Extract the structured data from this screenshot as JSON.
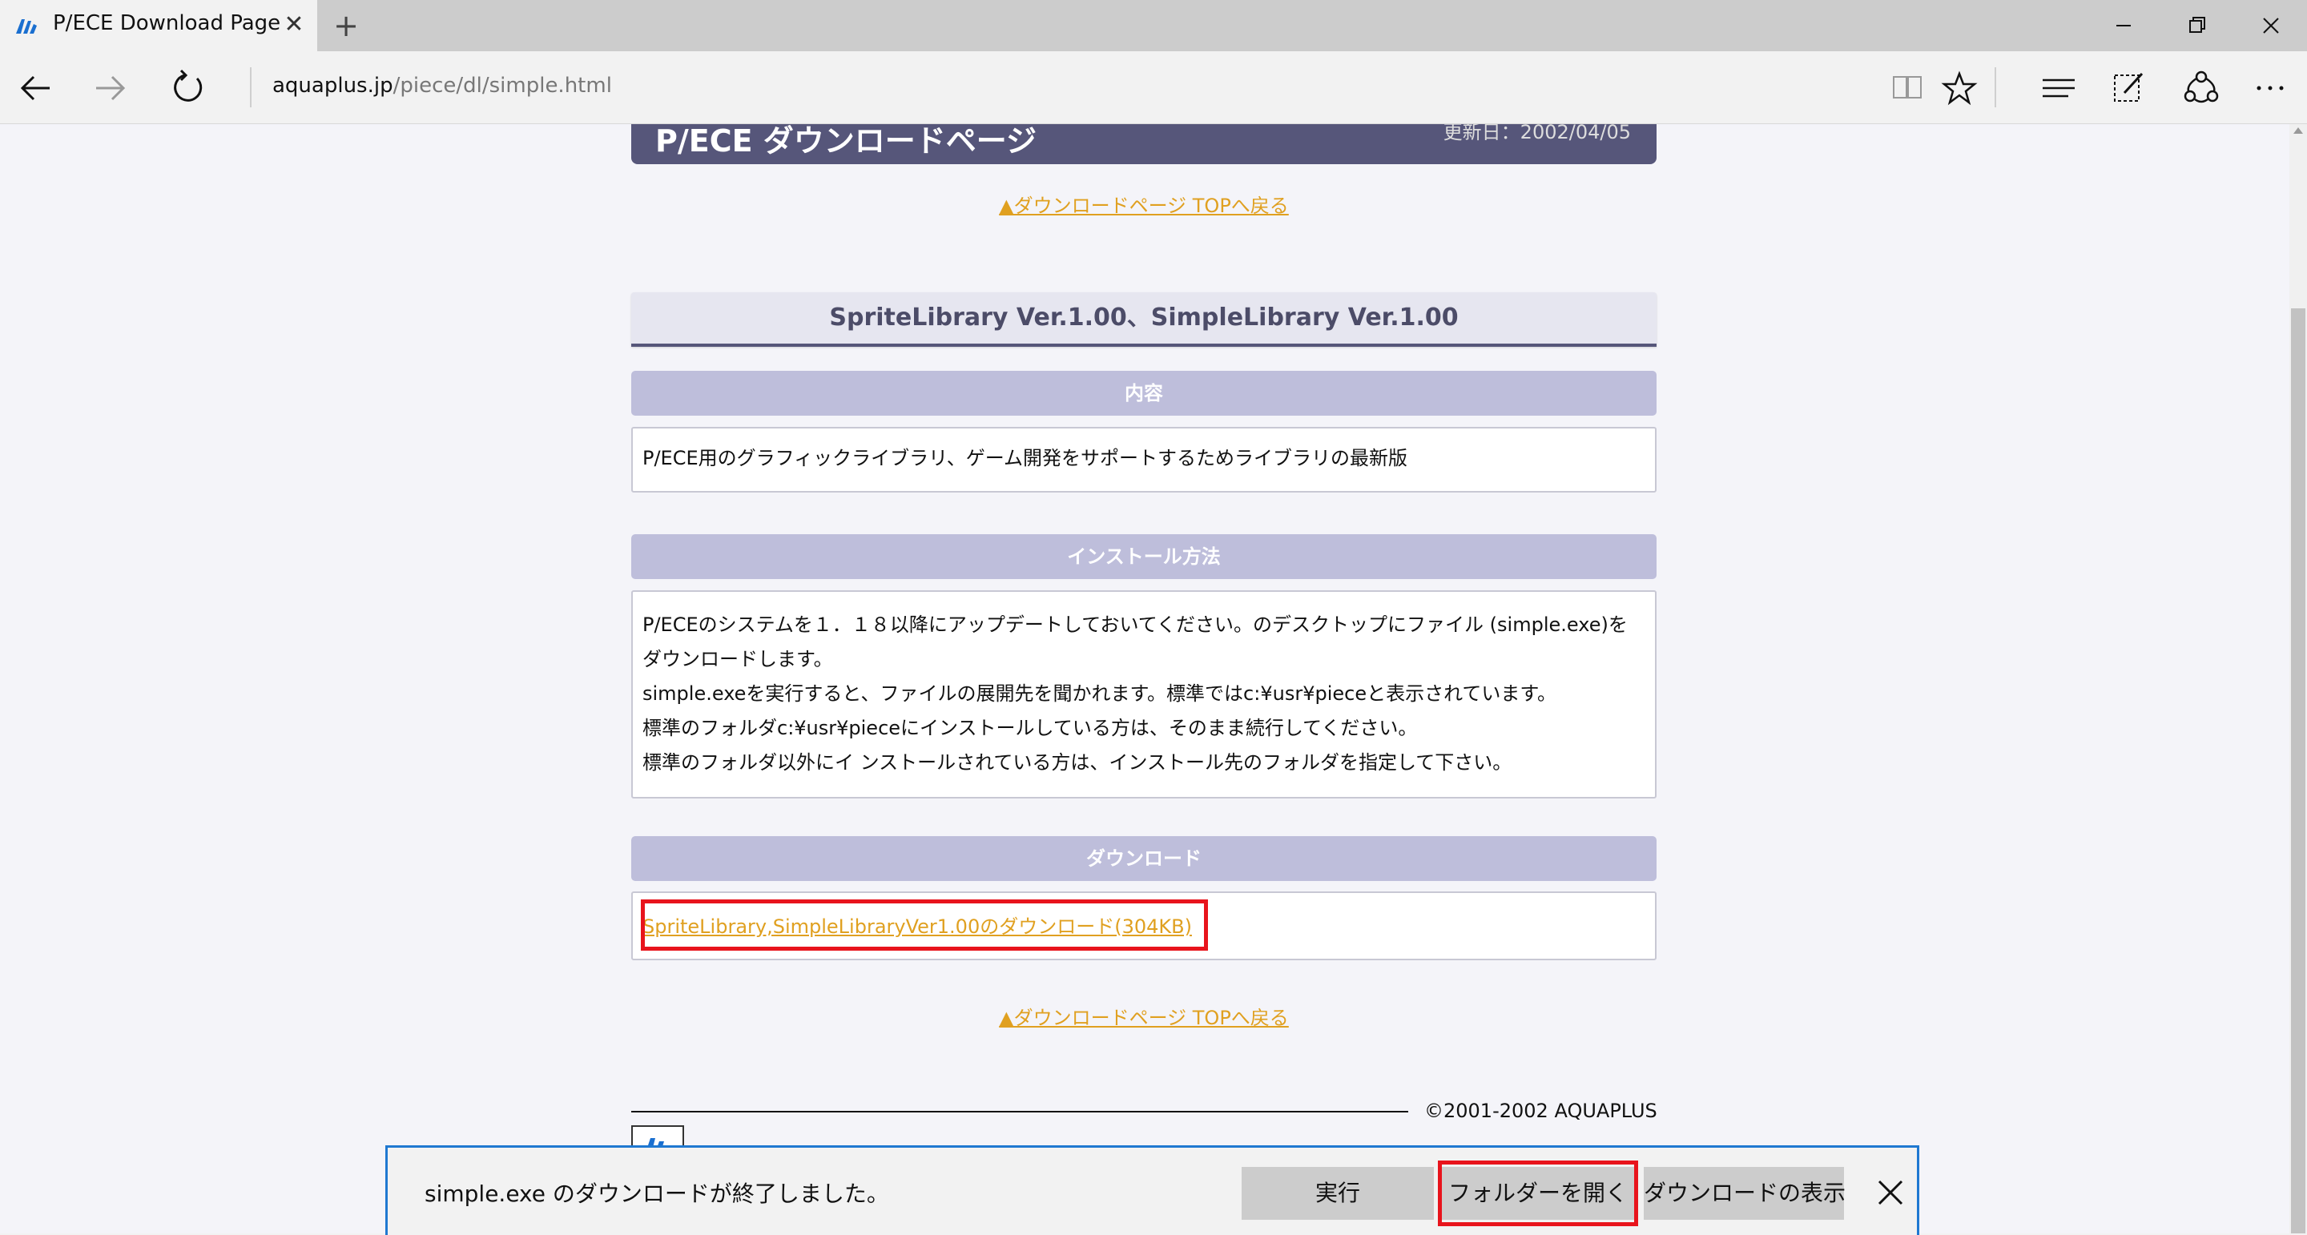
{
  "browser": {
    "tab_title": "P/ECE Download Page",
    "tab_close_glyph": "✕",
    "new_tab_glyph": "+",
    "url_host": "aquaplus.jp",
    "url_path": "/piece/dl/simple.html"
  },
  "page": {
    "header_title": "P/ECE ダウンロードページ",
    "header_date": "更新日：2002/04/05",
    "back_link": "▲ダウンロードページ TOPへ戻る",
    "section_title": "SpriteLibrary Ver.1.00、SimpleLibrary Ver.1.00",
    "contents_heading": "内容",
    "contents_text": "P/ECE用のグラフィックライブラリ、ゲーム開発をサポートするためライブラリの最新版",
    "install_heading": "インストール方法",
    "install_lines": [
      "P/ECEのシステムを１．１８以降にアップデートしておいてください。のデスクトップにファイル (simple.exe)を",
      "ダウンロードします。",
      "simple.exeを実行すると、ファイルの展開先を聞かれます。標準ではc:¥usr¥pieceと表示されています。",
      "標準のフォルダc:¥usr¥pieceにインストールしている方は、そのまま続行してください。",
      "標準のフォルダ以外にイ ンストールされている方は、インストール先のフォルダを指定して下さい。"
    ],
    "download_heading": "ダウンロード",
    "download_link": "SpriteLibrary,SimpleLibraryVer1.00のダウンロード(304KB)",
    "copyright": "©2001-2002 AQUAPLUS"
  },
  "download_bar": {
    "message": "simple.exe のダウンロードが終了しました。",
    "run_label": "実行",
    "open_folder_label": "フォルダーを開く",
    "view_downloads_label": "ダウンロードの表示"
  },
  "colors": {
    "accent": "#1f78d1",
    "link": "#e0a020",
    "header_bg": "#56567a",
    "bar_bg": "#bebedb",
    "highlight": "#e8141c"
  }
}
